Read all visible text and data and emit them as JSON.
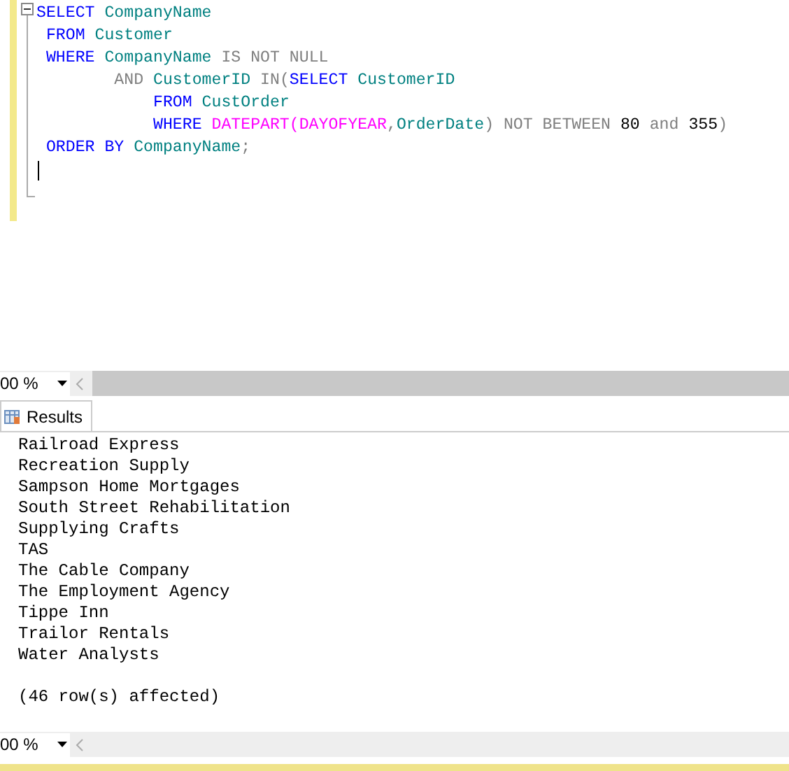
{
  "editor": {
    "lines": [
      {
        "tokens": [
          {
            "kind": "keyword",
            "text": "SELECT "
          },
          {
            "kind": "object",
            "text": "CompanyName"
          }
        ]
      },
      {
        "tokens": [
          {
            "kind": "keyword",
            "text": " FROM "
          },
          {
            "kind": "object",
            "text": "Customer"
          }
        ]
      },
      {
        "tokens": [
          {
            "kind": "keyword",
            "text": " WHERE "
          },
          {
            "kind": "object",
            "text": "CompanyName "
          },
          {
            "kind": "operator",
            "text": "IS NOT NULL"
          }
        ]
      },
      {
        "tokens": [
          {
            "kind": "operator",
            "text": "        AND "
          },
          {
            "kind": "object",
            "text": "CustomerID "
          },
          {
            "kind": "operator",
            "text": "IN("
          },
          {
            "kind": "keyword",
            "text": "SELECT "
          },
          {
            "kind": "object",
            "text": "CustomerID"
          }
        ]
      },
      {
        "tokens": [
          {
            "kind": "keyword",
            "text": "            FROM "
          },
          {
            "kind": "object",
            "text": "CustOrder"
          }
        ]
      },
      {
        "tokens": [
          {
            "kind": "keyword",
            "text": "            WHERE "
          },
          {
            "kind": "function",
            "text": "DATEPART(DAYOFYEAR"
          },
          {
            "kind": "operator",
            "text": ","
          },
          {
            "kind": "object",
            "text": "OrderDate"
          },
          {
            "kind": "operator",
            "text": ") NOT BETWEEN "
          },
          {
            "kind": "number",
            "text": "80"
          },
          {
            "kind": "operator",
            "text": " and "
          },
          {
            "kind": "number",
            "text": "355"
          },
          {
            "kind": "operator",
            "text": ")"
          }
        ]
      },
      {
        "tokens": [
          {
            "kind": "keyword",
            "text": " ORDER BY "
          },
          {
            "kind": "object",
            "text": "CompanyName"
          },
          {
            "kind": "operator",
            "text": ";"
          }
        ]
      }
    ]
  },
  "editor_zoom": "00 %",
  "results_tab": {
    "label": "Results",
    "selected": true
  },
  "results": [
    "Railroad Express",
    "Recreation Supply",
    "Sampson Home Mortgages",
    "South Street Rehabilitation",
    "Supplying Crafts",
    "TAS",
    "The Cable Company",
    "The Employment Agency",
    "Tippe Inn",
    "Trailor Rentals",
    "Water Analysts"
  ],
  "message": "(46 row(s) affected)",
  "results_zoom": "00 %"
}
